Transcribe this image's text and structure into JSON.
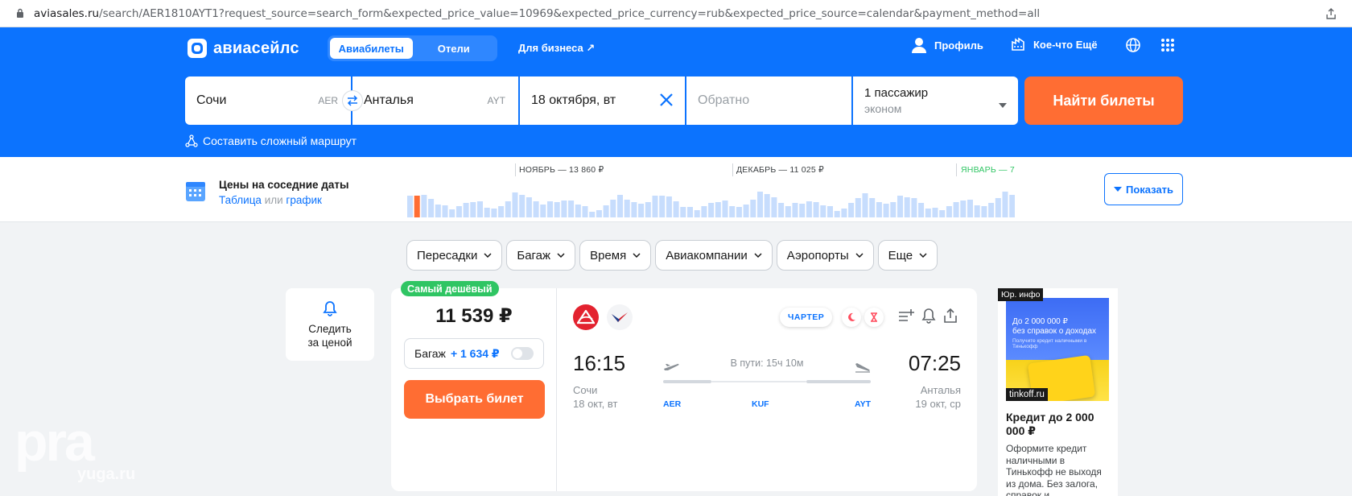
{
  "browser": {
    "url_host": "aviasales.ru",
    "url_path": "/search/AER1810AYT1?request_source=search_form&expected_price_value=10969&expected_price_currency=rub&expected_price_source=calendar&payment_method=all"
  },
  "header": {
    "logo_text": "авиасейлс",
    "tabs": [
      {
        "label": "Авиабилеты",
        "active": true
      },
      {
        "label": "Отели",
        "active": false
      }
    ],
    "business_link": "Для бизнеса ↗",
    "profile_label": "Профиль",
    "more_label": "Кое-что Ещё"
  },
  "search": {
    "from_city": "Сочи",
    "from_code": "AER",
    "to_city": "Анталья",
    "to_code": "AYT",
    "depart_date": "18 октября, вт",
    "return_placeholder": "Обратно",
    "passengers": "1 пассажир",
    "cabin_class": "эконом",
    "find_button": "Найти билеты",
    "complex_route": "Составить сложный маршрут"
  },
  "calendar_strip": {
    "title": "Цены на соседние даты",
    "link_table": "Таблица",
    "or_text": " или ",
    "link_chart": "график",
    "months": [
      {
        "label": "НОЯБРЬ — 13 860 ₽"
      },
      {
        "label": "ДЕКАБРЬ — 11 025 ₽"
      },
      {
        "label": "ЯНВАРЬ — 7"
      }
    ],
    "show_button": "Показать",
    "colors": {
      "bar": "#c7ddfd",
      "bar_selected": "#ff6d33",
      "january": "#2fc563"
    }
  },
  "filters": [
    {
      "label": "Пересадки"
    },
    {
      "label": "Багаж"
    },
    {
      "label": "Время"
    },
    {
      "label": "Авиакомпании"
    },
    {
      "label": "Аэропорты"
    },
    {
      "label": "Еще"
    }
  ],
  "follow_price": {
    "line1": "Следить",
    "line2": "за ценой"
  },
  "ticket": {
    "badge": "Самый дешёвый",
    "price": "11 539 ₽",
    "baggage_label": "Багаж",
    "baggage_price": "+ 1 634 ₽",
    "buy_button": "Выбрать билет",
    "charter_label": "ЧАРТЕР",
    "depart_time": "16:15",
    "depart_city": "Сочи",
    "depart_date": "18 окт, вт",
    "arrive_time": "07:25",
    "arrive_city": "Анталья",
    "arrive_date": "19 окт, ср",
    "duration": "В пути: 15ч 10м",
    "codes": [
      "AER",
      "KUF",
      "AYT"
    ]
  },
  "ad": {
    "tag": "Юр. инфо",
    "image_text_1": "До 2 000 000 ₽",
    "image_text_2": "без справок о доходах",
    "image_small": "Получите кредит наличными в Тинькофф",
    "domain": "tinkoff.ru",
    "title": "Кредит до 2 000 000 ₽",
    "description": "Оформите кредит наличными в Тинькофф не выходя из дома. Без залога, справок и..."
  },
  "watermark": {
    "big": "pra",
    "small": "yuga.ru"
  }
}
